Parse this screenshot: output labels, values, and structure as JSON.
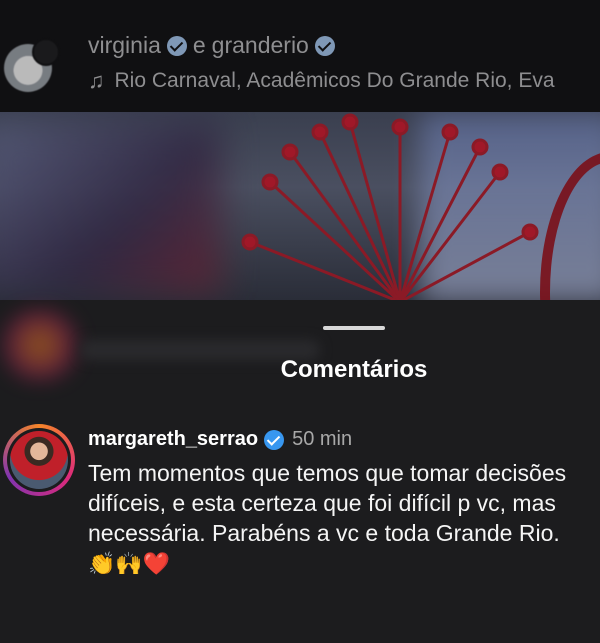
{
  "header": {
    "user1": "virginia",
    "connector": "e",
    "user2": "granderio",
    "audio": "Rio Carnaval, Acadêmicos Do Grande Rio, Eva"
  },
  "sheet": {
    "title": "Comentários"
  },
  "comment": {
    "username": "margareth_serrao",
    "time": "50 min",
    "text": "Tem momentos que temos que tomar decisões difíceis, e esta certeza que foi difícil p vc, mas necessária. Parabéns a vc e toda Grande Rio.",
    "emojis": "👏🙌❤️"
  },
  "colors": {
    "sheet_bg": "#1c1c1e",
    "verified_blue": "#3897f0"
  }
}
